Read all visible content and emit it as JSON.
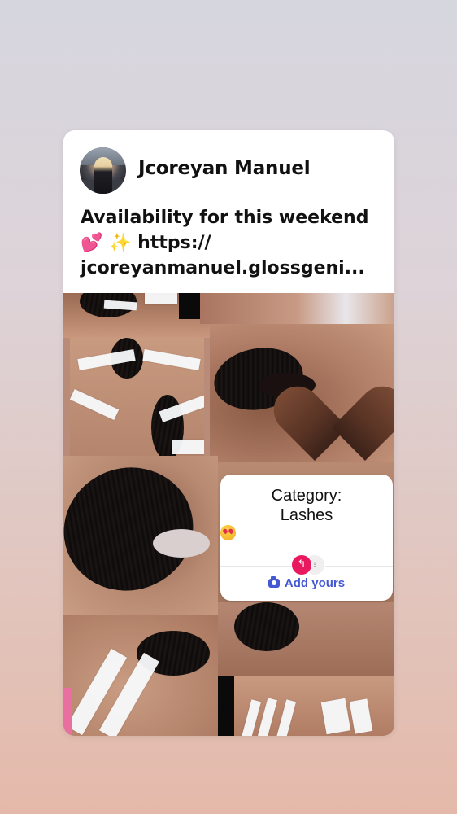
{
  "post": {
    "author": {
      "name": "Jcoreyan Manuel"
    },
    "caption": {
      "line1": "Availability for this weekend",
      "line2_emojis": "💕 ✨",
      "line2_text": "https://",
      "line3": "jcoreyanmanuel.glossgeni..."
    },
    "sticker": {
      "title_line1": "Category:",
      "title_line2": "Lashes",
      "title_emoji": "heart-eyes-emoji",
      "participant_icons": [
        "reply-arrow-icon",
        "participant-avatar"
      ],
      "reply_glyph": "↰",
      "action_label": "Add yours",
      "action_icon": "camera-icon"
    }
  },
  "colors": {
    "action_blue": "#4558d3",
    "participant_pink": "#e8195f"
  }
}
